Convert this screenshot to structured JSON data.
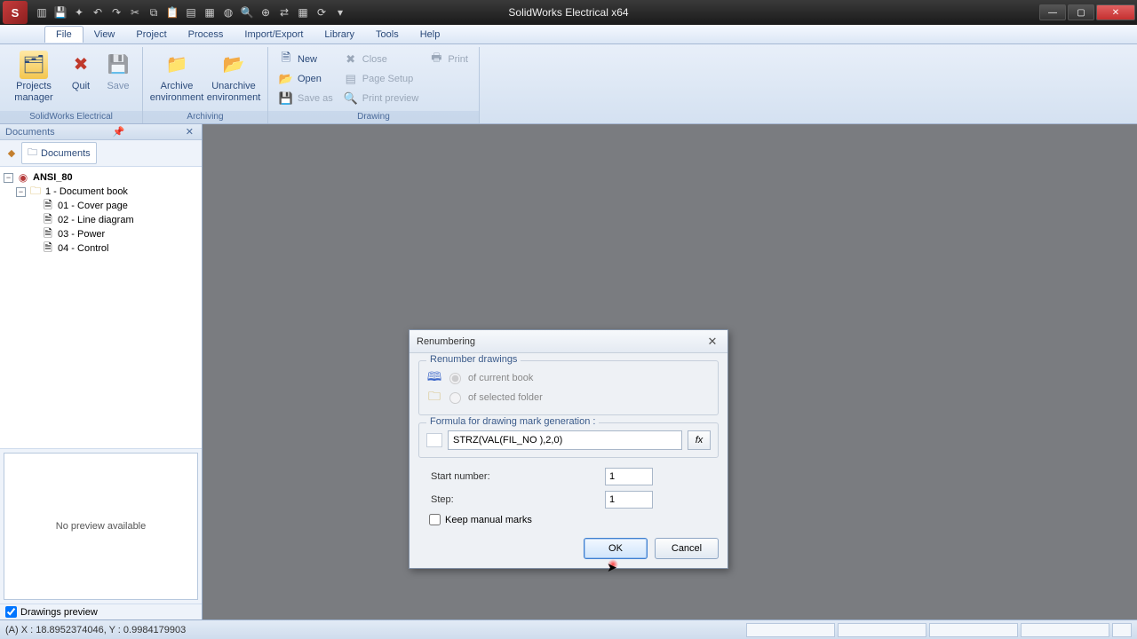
{
  "app": {
    "title": "SolidWorks Electrical x64"
  },
  "menubar": {
    "file": "File",
    "view": "View",
    "project": "Project",
    "process": "Process",
    "import_export": "Import/Export",
    "library": "Library",
    "tools": "Tools",
    "help": "Help"
  },
  "ribbon": {
    "group1_label": "SolidWorks Electrical",
    "projects_manager": "Projects\nmanager",
    "quit": "Quit",
    "save": "Save",
    "group2_label": "Archiving",
    "archive_env": "Archive\nenvironment",
    "unarchive_env": "Unarchive\nenvironment",
    "group3_label": "Drawing",
    "new": "New",
    "open": "Open",
    "save_as": "Save as",
    "close": "Close",
    "page_setup": "Page Setup",
    "print_preview": "Print preview",
    "print": "Print"
  },
  "dock": {
    "title": "Documents",
    "tab": "Documents",
    "tree": {
      "root": "ANSI_80",
      "book": "1 - Document book",
      "p1": "01 - Cover page",
      "p2": "02 - Line diagram",
      "p3": "03 - Power",
      "p4": "04 - Control"
    },
    "no_preview": "No preview available",
    "preview_check": "Drawings preview"
  },
  "dialog": {
    "title": "Renumbering",
    "group_renumber": "Renumber drawings",
    "of_current_book": "of current book",
    "of_selected_folder": "of selected folder",
    "group_formula": "Formula for drawing mark generation :",
    "formula_value": "STRZ(VAL(FIL_NO ),2,0)",
    "fx": "fx",
    "start_number_label": "Start number:",
    "start_number_value": "1",
    "step_label": "Step:",
    "step_value": "1",
    "keep_manual": "Keep manual marks",
    "ok": "OK",
    "cancel": "Cancel"
  },
  "status": {
    "coords": "(A) X : 18.8952374046, Y : 0.9984179903"
  }
}
